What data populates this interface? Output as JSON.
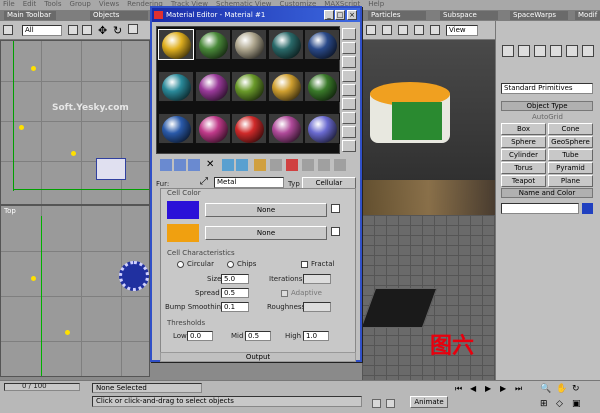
{
  "menubar": [
    "File",
    "Edit",
    "Tools",
    "Group",
    "Views",
    "Rendering",
    "Track View",
    "Schematic View",
    "Customize",
    "MAXScript",
    "Help"
  ],
  "tabs": [
    {
      "label": "Main Toolbar"
    },
    {
      "label": "Objects"
    },
    {
      "label": "Particles"
    },
    {
      "label": "Subspace"
    },
    {
      "label": "SpaceWarps"
    },
    {
      "label": "Modif"
    }
  ],
  "toolbar": {
    "selection_filter": "All",
    "viewport_combo": "View"
  },
  "viewports": {
    "top_left_label": "",
    "bottom_left_label": "Top"
  },
  "watermark": "Soft.Yesky.com",
  "material_editor": {
    "title": "Material Editor - Material #1",
    "spheres": [
      "#e0b020",
      "#4a8a3a",
      "#b0a890",
      "#2a6a6a",
      "#2a4a8a",
      "#2a8a9a",
      "#9a3a9a",
      "#6a9a2a",
      "#d0a030",
      "#3a7a2a",
      "#2a5aaa",
      "#c03a8a",
      "#d02a2a",
      "#b04a9a",
      "#6a6ad0"
    ],
    "type_label": "Fur:",
    "material_name": "Metal",
    "type_label2": "Typ",
    "type_button": "Cellular",
    "cell_color_section": "Cell Color",
    "map_none_1": "None",
    "map_none_2": "None",
    "cell_characteristics": "Cell Characteristics",
    "radio_circular": "Circular",
    "radio_chips": "Chips",
    "fractal_checkbox": "Fractal",
    "size_label": "Size",
    "size_value": "5.0",
    "iterations_label": "Iterations",
    "spread_label": "Spread",
    "spread_value": "0.5",
    "adaptive_label": "Adaptive",
    "bump_smoothing_label": "Bump Smoothing",
    "bump_smoothing_value": "0.1",
    "roughness_label": "Roughness",
    "thresholds_section": "Thresholds",
    "low_label": "Low",
    "low_value": "0.0",
    "mid_label": "Mid",
    "mid_value": "0.5",
    "high_label": "High",
    "high_value": "1.0",
    "output_rollout": "Output",
    "colors": {
      "blue_swatch": "#2a10d8",
      "orange_swatch": "#f0a010"
    }
  },
  "command_panel": {
    "category_combo": "Standard Primitives",
    "object_type_header": "Object Type",
    "autogrid_label": "AutoGrid",
    "buttons": [
      "Box",
      "Cone",
      "Sphere",
      "GeoSphere",
      "Cylinder",
      "Tube",
      "Torus",
      "Pyramid",
      "Teapot",
      "Plane"
    ],
    "name_color_header": "Name and Color"
  },
  "status": {
    "selection_info": "None Selected",
    "prompt": "Click or click-and-drag to select objects",
    "frame_counter": "0 / 100",
    "animate_label": "Animate"
  },
  "caption": "图六"
}
